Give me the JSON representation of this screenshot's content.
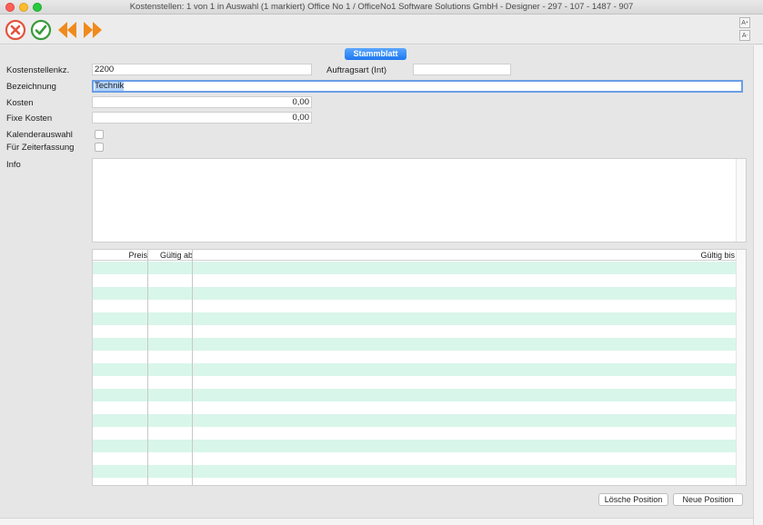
{
  "window": {
    "title": "Kostenstellen: 1 von 1 in Auswahl  (1 markiert) Office No 1 /  OfficeNo1 Software Solutions GmbH - Designer - 297 - 107 - 1487 - 907"
  },
  "toolbar": {
    "cancel_icon": "cancel-x-icon",
    "ok_icon": "checkmark-icon",
    "prev_icon": "double-chevron-left-icon",
    "next_icon": "double-chevron-right-icon",
    "font_up": "A",
    "font_down": "A"
  },
  "tab": {
    "label": "Stammblatt"
  },
  "form": {
    "kostenstellenkz_label": "Kostenstellenkz.",
    "kostenstellenkz_value": "2200",
    "auftragsart_label": "Auftragsart (Int)",
    "auftragsart_value": "",
    "bezeichnung_label": "Bezeichnung",
    "bezeichnung_value": "Technik",
    "kosten_label": "Kosten",
    "kosten_value": "0,00",
    "fixe_kosten_label": "Fixe Kosten",
    "fixe_kosten_value": "0,00",
    "kalenderauswahl_label": "Kalenderauswahl",
    "kalenderauswahl_checked": false,
    "zeiterfassung_label": "Für Zeiterfassung",
    "zeiterfassung_checked": false,
    "info_label": "Info",
    "info_value": ""
  },
  "grid": {
    "columns": [
      "Preis",
      "Gültig ab",
      "Gültig bis"
    ],
    "rows": [
      [
        "",
        "",
        ""
      ],
      [
        "",
        "",
        ""
      ],
      [
        "",
        "",
        ""
      ],
      [
        "",
        "",
        ""
      ],
      [
        "",
        "",
        ""
      ],
      [
        "",
        "",
        ""
      ],
      [
        "",
        "",
        ""
      ],
      [
        "",
        "",
        ""
      ],
      [
        "",
        "",
        ""
      ],
      [
        "",
        "",
        ""
      ],
      [
        "",
        "",
        ""
      ],
      [
        "",
        "",
        ""
      ],
      [
        "",
        "",
        ""
      ],
      [
        "",
        "",
        ""
      ],
      [
        "",
        "",
        ""
      ],
      [
        "",
        "",
        ""
      ],
      [
        "",
        "",
        ""
      ]
    ]
  },
  "buttons": {
    "delete_position": "Lösche Position",
    "new_position": "Neue Position"
  },
  "colors": {
    "accent": "#1e78f0",
    "row_mint": "#d9f6ea",
    "cancel_red": "#e5533d",
    "ok_green": "#3a9b3a",
    "nav_orange": "#f08a1c"
  }
}
